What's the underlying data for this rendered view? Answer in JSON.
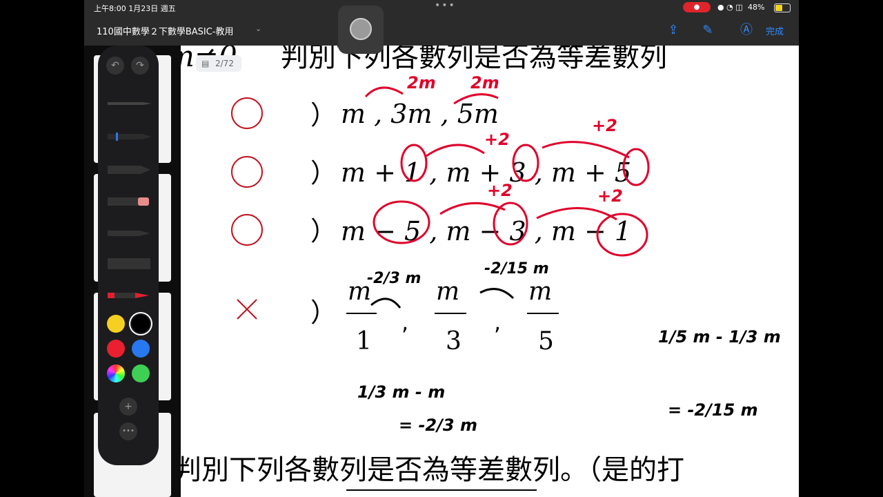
{
  "statusbar": {
    "time": "上午8:00  1月23日 週五",
    "dots": "•••",
    "battery": "48%",
    "battery_level": 0.48,
    "recording_indicator": "●"
  },
  "titlebar": {
    "doc_title": "110國中數學２下數學BASIC-教用",
    "done": "完成"
  },
  "page": {
    "indicator": "2/72",
    "heading": "判別下列各數列是否為等差數列",
    "bottom_line": "判別下列各數列是否為等差數列。（是的打",
    "problems": [
      {
        "mark": "○",
        "paren": "）",
        "expr": "m , 3m , 5m"
      },
      {
        "mark": "○",
        "paren": "）",
        "expr": "m + 1 , m + 3 , m + 5"
      },
      {
        "mark": "○",
        "paren": "）",
        "expr": "m − 5 , m − 3 , m − 1"
      },
      {
        "mark": "×",
        "paren": "）",
        "expr": "m/1 , m/3 , m/5"
      }
    ]
  },
  "annotations": {
    "diff_2m_a": "2m",
    "diff_2m_b": "2m",
    "plus2": "+2",
    "neg_2_3m": "-2/3 m",
    "neg_2_15m": "-2/15 m"
  },
  "palette": {
    "colors": [
      "#f5d020",
      "#000000",
      "#e8202f",
      "#2878f0",
      "rainbow",
      "#3ed054"
    ],
    "undo": "↶",
    "redo": "↷",
    "add": "+",
    "more": "•••"
  },
  "ink_color": "#e0002a"
}
